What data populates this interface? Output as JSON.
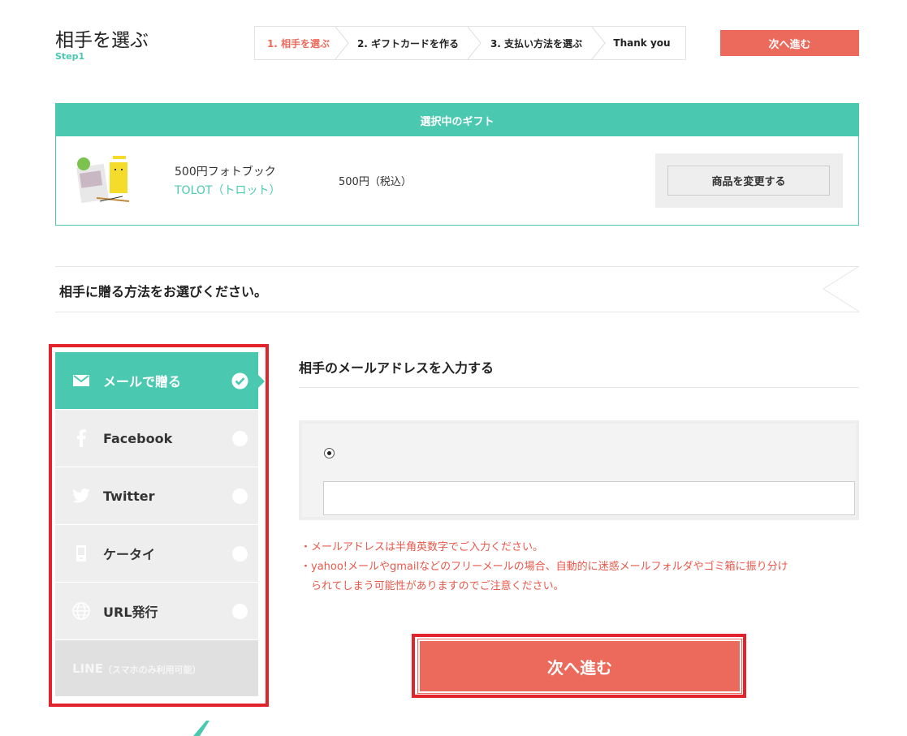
{
  "header": {
    "title": "相手を選ぶ",
    "step_label": "Step1",
    "next_label": "次へ進む"
  },
  "steps": [
    {
      "label": "1. 相手を選ぶ",
      "active": true
    },
    {
      "label": "2. ギフトカードを作る",
      "active": false
    },
    {
      "label": "3. 支払い方法を選ぶ",
      "active": false
    },
    {
      "label": "Thank you",
      "active": false
    }
  ],
  "gift": {
    "header": "選択中のギフト",
    "name": "500円フォトブック",
    "brand": "TOLOT（トロット）",
    "price": "500円（税込）",
    "change_label": "商品を変更する"
  },
  "section": {
    "title": "相手に贈る方法をお選びください。"
  },
  "methods": [
    {
      "label": "メールで贈る",
      "icon": "envelope-icon",
      "selected": true
    },
    {
      "label": "Facebook",
      "icon": "facebook-icon",
      "selected": false
    },
    {
      "label": "Twitter",
      "icon": "twitter-icon",
      "selected": false
    },
    {
      "label": "ケータイ",
      "icon": "mobile-phone-icon",
      "selected": false
    },
    {
      "label": "URL発行",
      "icon": "globe-icon",
      "selected": false
    },
    {
      "label": "LINE",
      "sub": "（スマホのみ利用可能）",
      "disabled": true
    }
  ],
  "email": {
    "heading": "相手のメールアドレスを入力する",
    "input_value": "",
    "notes": [
      "・メールアドレスは半角英数字でご入力ください。",
      "・yahoo!メールやgmailなどのフリーメールの場合、自動的に迷惑メールフォルダやゴミ箱に振り分け",
      "られてしまう可能性がありますのでご注意ください。"
    ]
  },
  "footer": {
    "next_label": "次へ進む"
  },
  "colors": {
    "accent": "#4bc9b0",
    "primary_button": "#eb6a5b",
    "highlight_frame": "#e3232c",
    "note_text": "#e8584a"
  }
}
